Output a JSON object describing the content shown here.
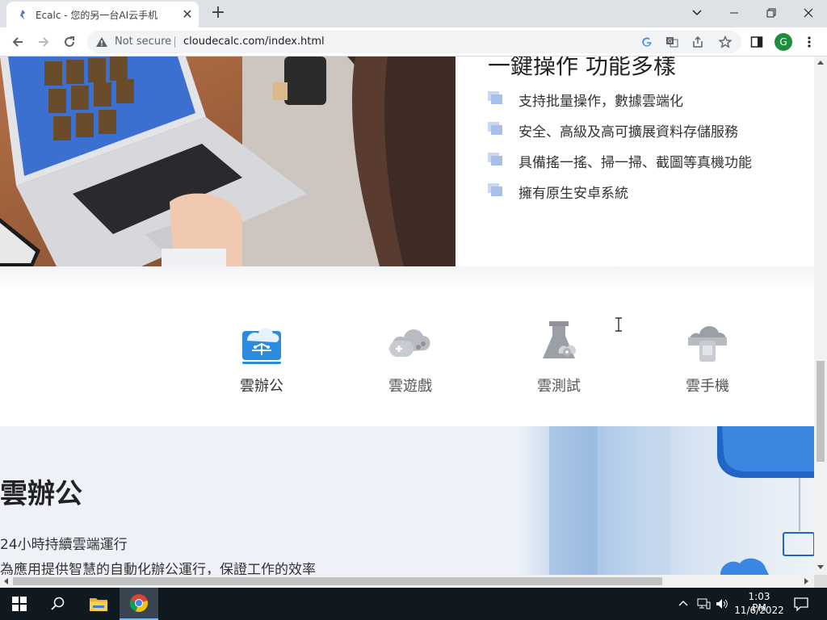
{
  "browser": {
    "tab_title": "Ecalc - 您的另一台AI云手机",
    "address": {
      "security_label": "Not secure",
      "url": "cloudecalc.com/index.html"
    },
    "profile_initial": "G"
  },
  "hero": {
    "heading": "一鍵操作 功能多樣",
    "features": [
      "支持批量操作，數據雲端化",
      "安全、高級及高可擴展資料存儲服務",
      "具備搖一搖、掃一掃、截圖等真機功能",
      "擁有原生安卓系統"
    ]
  },
  "services": [
    {
      "label": "雲辦公",
      "icon": "cloud-office-icon",
      "active": true
    },
    {
      "label": "雲遊戲",
      "icon": "cloud-game-icon",
      "active": false
    },
    {
      "label": "雲測試",
      "icon": "cloud-test-icon",
      "active": false
    },
    {
      "label": "雲手機",
      "icon": "cloud-phone-icon",
      "active": false
    }
  ],
  "office_section": {
    "title": "雲辦公",
    "line1": "24小時持續雲端運行",
    "line2": "為應用提供智慧的自動化辦公運行，保證工作的效率"
  },
  "taskbar": {
    "time": "1:03 PM",
    "date": "11/6/2022"
  },
  "colors": {
    "accent_blue": "#2b8bdf",
    "icon_gray": "#9aa0a6",
    "section_bg": "#eef2f8",
    "taskbar_bg": "#101820"
  }
}
